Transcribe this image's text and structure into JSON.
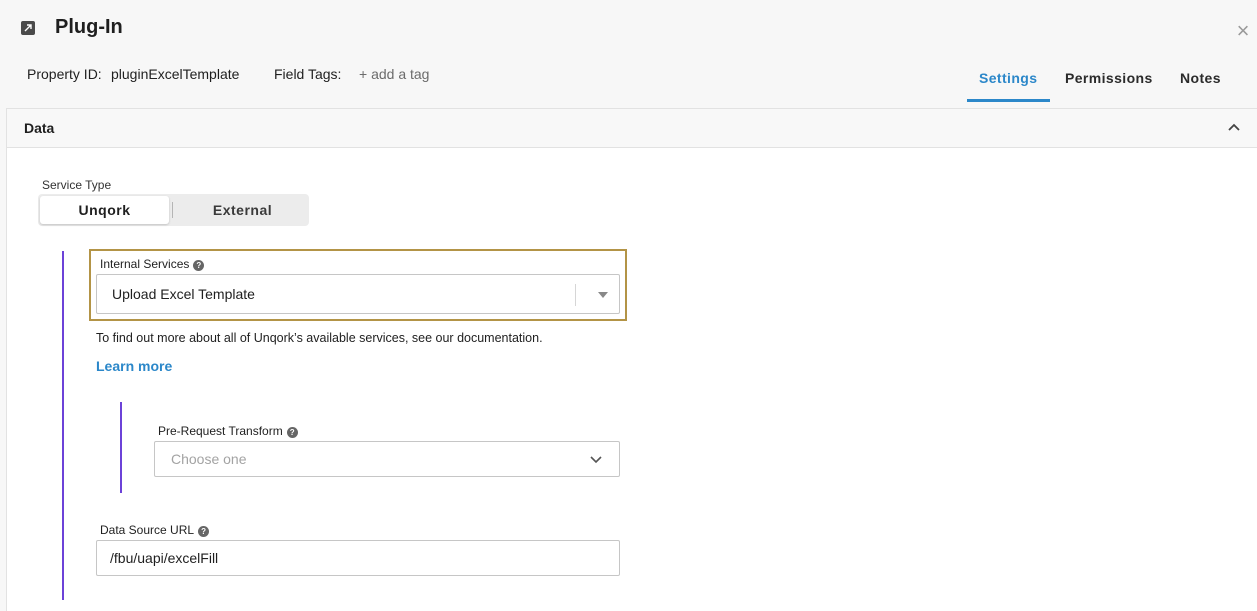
{
  "header": {
    "icon": "plugin-icon",
    "title": "Plug-In",
    "property_label": "Property ID:",
    "property_value": "pluginExcelTemplate",
    "field_tags_label": "Field Tags:",
    "add_tag": "+ add a tag",
    "close_icon": "close-icon"
  },
  "tabs": [
    {
      "label": "Settings",
      "active": true
    },
    {
      "label": "Permissions",
      "active": false
    },
    {
      "label": "Notes",
      "active": false
    }
  ],
  "panel": {
    "title": "Data",
    "collapse_icon": "chevron-up-icon"
  },
  "service_type": {
    "label": "Service Type",
    "options": [
      "Unqork",
      "External"
    ],
    "selected": "Unqork"
  },
  "internal_services": {
    "label": "Internal Services",
    "value": "Upload Excel Template",
    "help_text": "To find out more about all of Unqork’s available services, see our documentation.",
    "learn_more": "Learn more"
  },
  "pre_request_transform": {
    "label": "Pre-Request Transform",
    "placeholder": "Choose one"
  },
  "data_source_url": {
    "label": "Data Source URL",
    "value": "/fbu/uapi/excelFill"
  },
  "colors": {
    "accent": "#2b87c9",
    "purple_bar": "#6c42d8",
    "highlight_border": "#b39446"
  }
}
